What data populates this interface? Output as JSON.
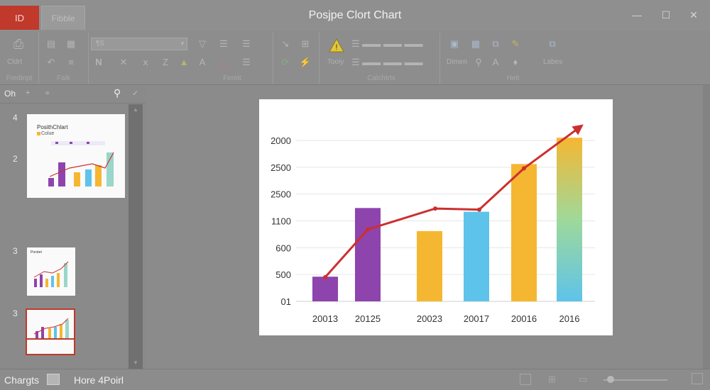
{
  "titlebar": {
    "app_tab": "ID",
    "file_tab": "Fibble",
    "title": "Posjpe Clort Chart"
  },
  "ribbon": {
    "font_box": "¶S",
    "clipboard_label": "Cldrt",
    "groups": [
      "Fredinpt",
      "Falk",
      "Fereit",
      "Calchtrts",
      "Heit"
    ],
    "today_label": "Tooiy",
    "dimen_label": "Dimen",
    "labes_label": "Labes"
  },
  "left_panel": {
    "header": "Oh",
    "slide_numbers": [
      "4",
      "2",
      "3",
      "3"
    ],
    "thumb1_title": "PosithChlart",
    "thumb1_sub": "Colue",
    "thumb2_title": "Porstet"
  },
  "status": {
    "left": "Chargts",
    "right": "Hore 4Poirl"
  },
  "colors": {
    "accent": "#c0392b",
    "trend_line": "#cc2f2f",
    "bar_purple": "#8e44ad",
    "bar_yellow": "#f5b731",
    "bar_blue": "#5ec3ea"
  },
  "chart_data": {
    "type": "bar",
    "categories": [
      "20013",
      "20125",
      "20023",
      "20017",
      "20016",
      "2016"
    ],
    "values": [
      460,
      1740,
      1310,
      1670,
      2560,
      3050
    ],
    "trend": [
      450,
      1340,
      1730,
      1710,
      2480,
      3250
    ],
    "y_tick_labels": [
      "01",
      "500",
      "600",
      "1100",
      "2500",
      "2500",
      "2000"
    ],
    "ylim": [
      0,
      3000
    ],
    "grid": true,
    "bar_colors": [
      "purple",
      "purple",
      "yellow",
      "blue",
      "yellow",
      "gradient"
    ]
  }
}
